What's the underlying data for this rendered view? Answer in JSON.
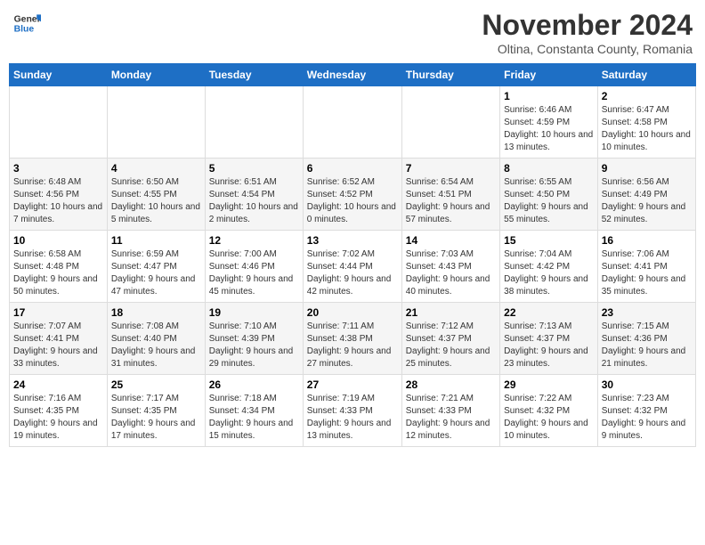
{
  "header": {
    "logo_general": "General",
    "logo_blue": "Blue",
    "month_title": "November 2024",
    "location": "Oltina, Constanta County, Romania"
  },
  "days_of_week": [
    "Sunday",
    "Monday",
    "Tuesday",
    "Wednesday",
    "Thursday",
    "Friday",
    "Saturday"
  ],
  "weeks": [
    {
      "cells": [
        {
          "empty": true
        },
        {
          "empty": true
        },
        {
          "empty": true
        },
        {
          "empty": true
        },
        {
          "empty": true
        },
        {
          "day": 1,
          "sunrise": "6:46 AM",
          "sunset": "4:59 PM",
          "daylight": "10 hours and 13 minutes."
        },
        {
          "day": 2,
          "sunrise": "6:47 AM",
          "sunset": "4:58 PM",
          "daylight": "10 hours and 10 minutes."
        }
      ]
    },
    {
      "cells": [
        {
          "day": 3,
          "sunrise": "6:48 AM",
          "sunset": "4:56 PM",
          "daylight": "10 hours and 7 minutes."
        },
        {
          "day": 4,
          "sunrise": "6:50 AM",
          "sunset": "4:55 PM",
          "daylight": "10 hours and 5 minutes."
        },
        {
          "day": 5,
          "sunrise": "6:51 AM",
          "sunset": "4:54 PM",
          "daylight": "10 hours and 2 minutes."
        },
        {
          "day": 6,
          "sunrise": "6:52 AM",
          "sunset": "4:52 PM",
          "daylight": "10 hours and 0 minutes."
        },
        {
          "day": 7,
          "sunrise": "6:54 AM",
          "sunset": "4:51 PM",
          "daylight": "9 hours and 57 minutes."
        },
        {
          "day": 8,
          "sunrise": "6:55 AM",
          "sunset": "4:50 PM",
          "daylight": "9 hours and 55 minutes."
        },
        {
          "day": 9,
          "sunrise": "6:56 AM",
          "sunset": "4:49 PM",
          "daylight": "9 hours and 52 minutes."
        }
      ]
    },
    {
      "cells": [
        {
          "day": 10,
          "sunrise": "6:58 AM",
          "sunset": "4:48 PM",
          "daylight": "9 hours and 50 minutes."
        },
        {
          "day": 11,
          "sunrise": "6:59 AM",
          "sunset": "4:47 PM",
          "daylight": "9 hours and 47 minutes."
        },
        {
          "day": 12,
          "sunrise": "7:00 AM",
          "sunset": "4:46 PM",
          "daylight": "9 hours and 45 minutes."
        },
        {
          "day": 13,
          "sunrise": "7:02 AM",
          "sunset": "4:44 PM",
          "daylight": "9 hours and 42 minutes."
        },
        {
          "day": 14,
          "sunrise": "7:03 AM",
          "sunset": "4:43 PM",
          "daylight": "9 hours and 40 minutes."
        },
        {
          "day": 15,
          "sunrise": "7:04 AM",
          "sunset": "4:42 PM",
          "daylight": "9 hours and 38 minutes."
        },
        {
          "day": 16,
          "sunrise": "7:06 AM",
          "sunset": "4:41 PM",
          "daylight": "9 hours and 35 minutes."
        }
      ]
    },
    {
      "cells": [
        {
          "day": 17,
          "sunrise": "7:07 AM",
          "sunset": "4:41 PM",
          "daylight": "9 hours and 33 minutes."
        },
        {
          "day": 18,
          "sunrise": "7:08 AM",
          "sunset": "4:40 PM",
          "daylight": "9 hours and 31 minutes."
        },
        {
          "day": 19,
          "sunrise": "7:10 AM",
          "sunset": "4:39 PM",
          "daylight": "9 hours and 29 minutes."
        },
        {
          "day": 20,
          "sunrise": "7:11 AM",
          "sunset": "4:38 PM",
          "daylight": "9 hours and 27 minutes."
        },
        {
          "day": 21,
          "sunrise": "7:12 AM",
          "sunset": "4:37 PM",
          "daylight": "9 hours and 25 minutes."
        },
        {
          "day": 22,
          "sunrise": "7:13 AM",
          "sunset": "4:37 PM",
          "daylight": "9 hours and 23 minutes."
        },
        {
          "day": 23,
          "sunrise": "7:15 AM",
          "sunset": "4:36 PM",
          "daylight": "9 hours and 21 minutes."
        }
      ]
    },
    {
      "cells": [
        {
          "day": 24,
          "sunrise": "7:16 AM",
          "sunset": "4:35 PM",
          "daylight": "9 hours and 19 minutes."
        },
        {
          "day": 25,
          "sunrise": "7:17 AM",
          "sunset": "4:35 PM",
          "daylight": "9 hours and 17 minutes."
        },
        {
          "day": 26,
          "sunrise": "7:18 AM",
          "sunset": "4:34 PM",
          "daylight": "9 hours and 15 minutes."
        },
        {
          "day": 27,
          "sunrise": "7:19 AM",
          "sunset": "4:33 PM",
          "daylight": "9 hours and 13 minutes."
        },
        {
          "day": 28,
          "sunrise": "7:21 AM",
          "sunset": "4:33 PM",
          "daylight": "9 hours and 12 minutes."
        },
        {
          "day": 29,
          "sunrise": "7:22 AM",
          "sunset": "4:32 PM",
          "daylight": "9 hours and 10 minutes."
        },
        {
          "day": 30,
          "sunrise": "7:23 AM",
          "sunset": "4:32 PM",
          "daylight": "9 hours and 9 minutes."
        }
      ]
    }
  ]
}
